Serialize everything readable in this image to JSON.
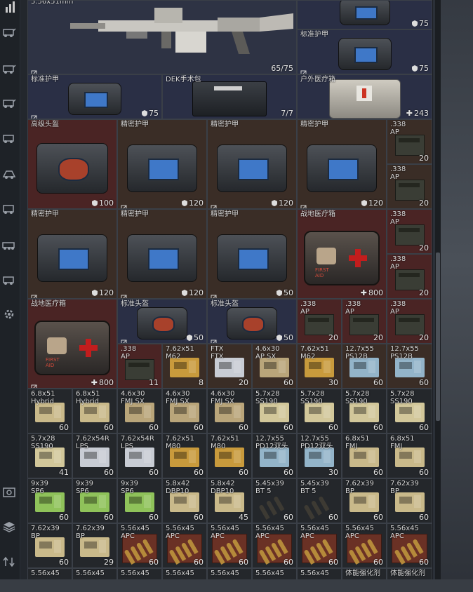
{
  "sidebar": {
    "icons": [
      "vehicle-icon",
      "vehicle-icon",
      "vehicle-icon",
      "vehicle-icon",
      "vehicle-icon",
      "vehicle-icon",
      "vehicle-icon",
      "vehicle-icon",
      "vehicle-icon",
      "gear-icon",
      "camera-icon",
      "layers-icon",
      "transfer-icon"
    ]
  },
  "stash": {
    "top_left_partial_title": "5.56x51mm",
    "rifle": {
      "count": "65/75"
    },
    "row0_right_top": {
      "count": "75"
    },
    "row0_right_bottom": {
      "name": "标准护甲",
      "count": "75"
    },
    "row1": [
      {
        "name": "标准护甲",
        "count": "75"
      },
      {
        "name": "DEK手术包",
        "count": "7/7"
      },
      {
        "name": "户外医疗箱",
        "count": "243"
      }
    ],
    "row2": [
      {
        "name": "高级头盔",
        "count": "100"
      },
      {
        "name": "精密护甲",
        "count": "120"
      },
      {
        "name": "精密护甲",
        "count": "120"
      },
      {
        "name": "精密护甲",
        "count": "120"
      }
    ],
    "ap_col": [
      {
        "name": ".338\nAP",
        "count": "20"
      },
      {
        "name": ".338\nAP",
        "count": "20"
      },
      {
        "name": ".338\nAP",
        "count": "20"
      },
      {
        "name": ".338\nAP",
        "count": "20"
      }
    ],
    "row3": [
      {
        "name": "精密护甲",
        "count": "120"
      },
      {
        "name": "精密护甲",
        "count": "120"
      },
      {
        "name": "精密护甲",
        "count": "50"
      },
      {
        "name": "战地医疗箱",
        "count": "800"
      }
    ],
    "row4": [
      {
        "name": "战地医疗箱",
        "count": "800"
      },
      {
        "name": "标准头盔",
        "count": "50"
      },
      {
        "name": "标准头盔",
        "count": "50"
      },
      {
        "name": ".338\nAP",
        "count": "20"
      },
      {
        "name": ".338\nAP",
        "count": "20"
      },
      {
        "name": ".338\nAP",
        "count": "20"
      }
    ],
    "row5": [
      {
        "name": ".338\nAP",
        "count": "11"
      },
      {
        "name": "7.62x51\nM62",
        "count": "8"
      },
      {
        "name": "FTX\nFTX",
        "count": "20"
      },
      {
        "name": "4.6x30\nAP SX",
        "count": "60"
      },
      {
        "name": "7.62x51\nM62",
        "count": "30"
      },
      {
        "name": "12.7x55\nPS12B",
        "count": "60"
      },
      {
        "name": "12.7x55\nPS12B",
        "count": "60"
      }
    ],
    "row6": [
      {
        "name": "6.8x51\nHybrid",
        "count": "60"
      },
      {
        "name": "6.8x51\nHybrid",
        "count": "60"
      },
      {
        "name": "4.6x30\nFMJ SX",
        "count": "60"
      },
      {
        "name": "4.6x30\nFMJ SX",
        "count": "60"
      },
      {
        "name": "4.6x30\nFMJ SX",
        "count": "60"
      },
      {
        "name": "5.7x28\nSS190",
        "count": "60"
      },
      {
        "name": "5.7x28\nSS190",
        "count": "60"
      },
      {
        "name": "5.7x28\nSS190",
        "count": "60"
      },
      {
        "name": "5.7x28\nSS190",
        "count": "60"
      }
    ],
    "row7": [
      {
        "name": "5.7x28\nSS190",
        "count": "41"
      },
      {
        "name": "7.62x54R\nLPS",
        "count": "60"
      },
      {
        "name": "7.62x54R\nLPS",
        "count": "60"
      },
      {
        "name": "7.62x51\nM80",
        "count": "60"
      },
      {
        "name": "7.62x51\nM80",
        "count": "60"
      },
      {
        "name": "12.7x55\nPD12双头",
        "count": "60"
      },
      {
        "name": "12.7x55\nPD12双头",
        "count": "30"
      },
      {
        "name": "6.8x51\nFMJ",
        "count": "60"
      },
      {
        "name": "6.8x51\nFMJ",
        "count": "60"
      }
    ],
    "row8": [
      {
        "name": "9x39\nSP6",
        "count": "60"
      },
      {
        "name": "9x39\nSP6",
        "count": "60"
      },
      {
        "name": "9x39\nSP6",
        "count": "60"
      },
      {
        "name": "5.8x42\nDBP10",
        "count": "60"
      },
      {
        "name": "5.8x42\nDBP10",
        "count": "45"
      },
      {
        "name": "5.45x39\nBT 5",
        "count": "60"
      },
      {
        "name": "5.45x39\nBT 5",
        "count": "60"
      },
      {
        "name": "7.62x39\nBP",
        "count": "60"
      },
      {
        "name": "7.62x39\nBP",
        "count": "60"
      }
    ],
    "row9": [
      {
        "name": "7.62x39\nBP",
        "count": "60"
      },
      {
        "name": "7.62x39\nBP",
        "count": "29"
      },
      {
        "name": "5.56x45\nAPC",
        "count": "60"
      },
      {
        "name": "5.56x45\nAPC",
        "count": "60"
      },
      {
        "name": "5.56x45\nAPC",
        "count": "60"
      },
      {
        "name": "5.56x45\nAPC",
        "count": "60"
      },
      {
        "name": "5.56x45\nAPC",
        "count": "60"
      },
      {
        "name": "5.56x45\nAPC",
        "count": "60"
      },
      {
        "name": "5.56x45\nAPC",
        "count": "60"
      }
    ],
    "row10": [
      "5.56x45",
      "5.56x45",
      "5.56x45",
      "5.56x45",
      "5.56x45",
      "5.56x45",
      "5.56x45",
      "体能强化剂",
      "体能强化剂"
    ]
  }
}
